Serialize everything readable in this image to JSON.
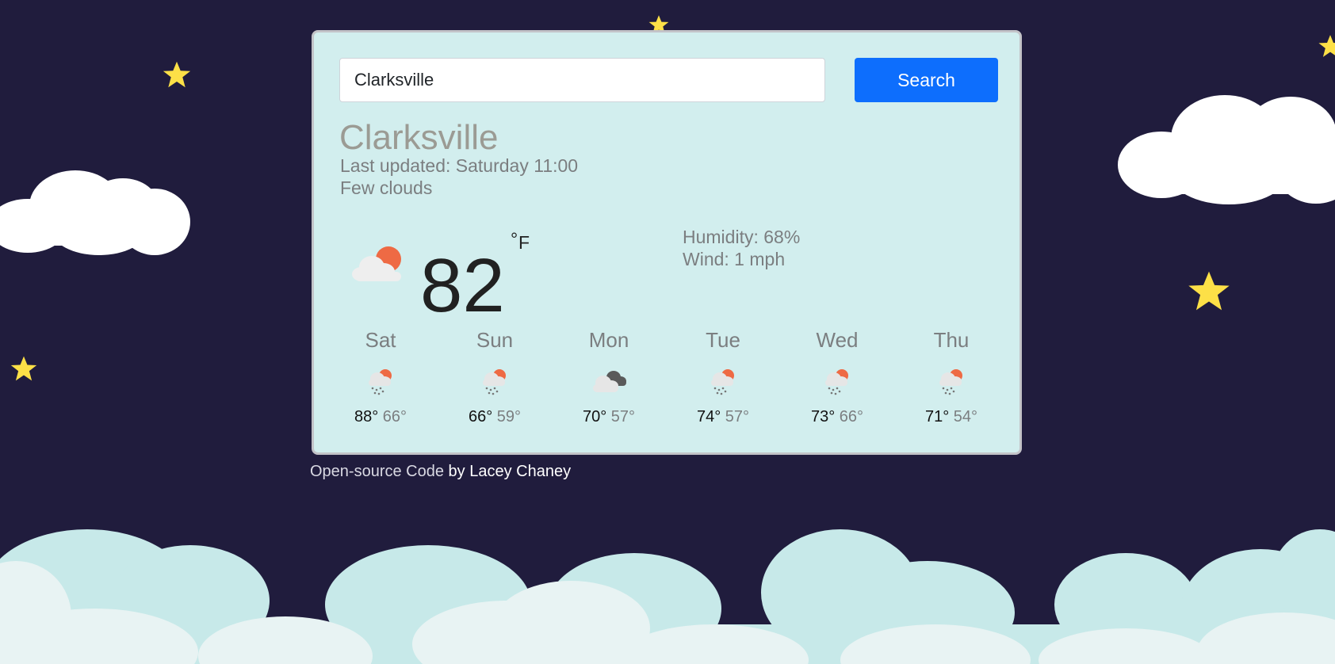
{
  "search": {
    "value": "Clarksville",
    "button_label": "Search"
  },
  "current": {
    "city": "Clarksville",
    "last_updated": "Last updated: Saturday 11:00",
    "description": "Few clouds",
    "icon": "few-clouds-day-icon",
    "temperature": "82",
    "unit": "F",
    "degree_symbol": "°",
    "humidity": "Humidity: 68%",
    "wind": "Wind: 1 mph"
  },
  "forecast": [
    {
      "day": "Sat",
      "icon": "rain-sun-icon",
      "max": "88°",
      "min": "66°"
    },
    {
      "day": "Sun",
      "icon": "rain-sun-icon",
      "max": "66°",
      "min": "59°"
    },
    {
      "day": "Mon",
      "icon": "cloudy-icon",
      "max": "70°",
      "min": "57°"
    },
    {
      "day": "Tue",
      "icon": "rain-sun-icon",
      "max": "74°",
      "min": "57°"
    },
    {
      "day": "Wed",
      "icon": "rain-sun-icon",
      "max": "73°",
      "min": "66°"
    },
    {
      "day": "Thu",
      "icon": "rain-sun-icon",
      "max": "71°",
      "min": "54°"
    }
  ],
  "footer": {
    "code_link": "Open-source Code",
    "by_text": " by ",
    "author_link": "Lacey Chaney"
  },
  "colors": {
    "background": "#201c3d",
    "card": "#d2eeee",
    "button": "#0d6efd",
    "star": "#fde047"
  }
}
